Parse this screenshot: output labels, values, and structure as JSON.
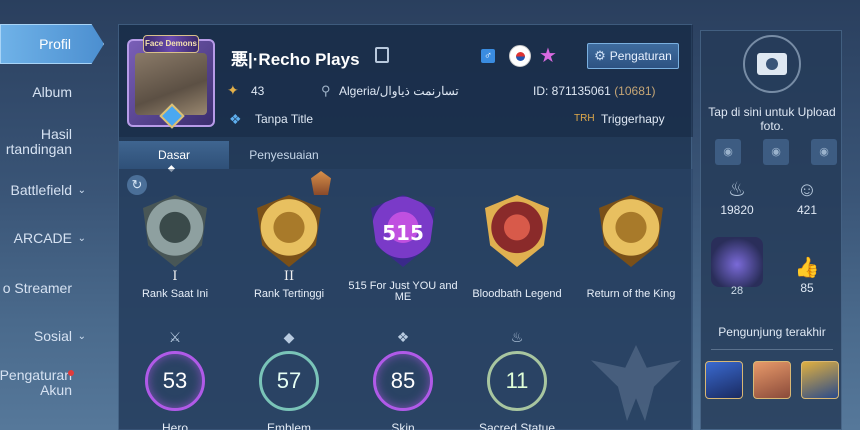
{
  "sidebar": {
    "items": [
      {
        "label": "Profil",
        "active": true
      },
      {
        "label": "Album"
      },
      {
        "label": "Hasil\nrtandingan"
      },
      {
        "label": "Battlefield",
        "chevron": true
      },
      {
        "label": "ARCADE",
        "chevron": true
      },
      {
        "label": "o Streamer"
      },
      {
        "label": "Sosial",
        "chevron": true
      },
      {
        "label": "Pengaturan\nAkun",
        "notify": true
      }
    ]
  },
  "profile": {
    "frame_text": "Face Demons",
    "name": "悪|·Recho Plays",
    "level": "43",
    "location": "Algeria/تسارنمت ذياوال",
    "id_label": "ID: 871135061",
    "zone": "(10681)",
    "title": "Tanpa Title",
    "trh_label": "TRH",
    "trh_name": "Triggerhapy",
    "settings_label": "Pengaturan"
  },
  "tabs": [
    {
      "label": "Dasar",
      "active": true
    },
    {
      "label": "Penyesuaian"
    }
  ],
  "medals": [
    {
      "caption": "Rank Saat Ini",
      "roman": "I",
      "style": "silver"
    },
    {
      "caption": "Rank Tertinggi",
      "roman": "II",
      "style": "gold"
    },
    {
      "caption": "515 For Just YOU and ME",
      "roman": "",
      "badge": "515",
      "style": "purple"
    },
    {
      "caption": "Bloodbath Legend",
      "roman": "",
      "style": "red"
    },
    {
      "caption": "Return of the King",
      "roman": "",
      "style": "gold"
    }
  ],
  "stats": [
    {
      "label": "Hero",
      "value": "53",
      "style": "violet"
    },
    {
      "label": "Emblem",
      "value": "57",
      "style": "teal"
    },
    {
      "label": "Skin",
      "value": "85",
      "style": "violet"
    },
    {
      "label": "Sacred Statue",
      "value": "11",
      "style": "pale"
    }
  ],
  "right_panel": {
    "upload_text": "Tap di sini untuk Upload foto.",
    "popularity": "19820",
    "followers": "421",
    "pet_level": "28",
    "likes": "85",
    "visitors_title": "Pengunjung terakhir"
  },
  "colors": {
    "accent": "#5aa4e6",
    "gold": "#e0a94a",
    "violet": "#b05ae8"
  }
}
